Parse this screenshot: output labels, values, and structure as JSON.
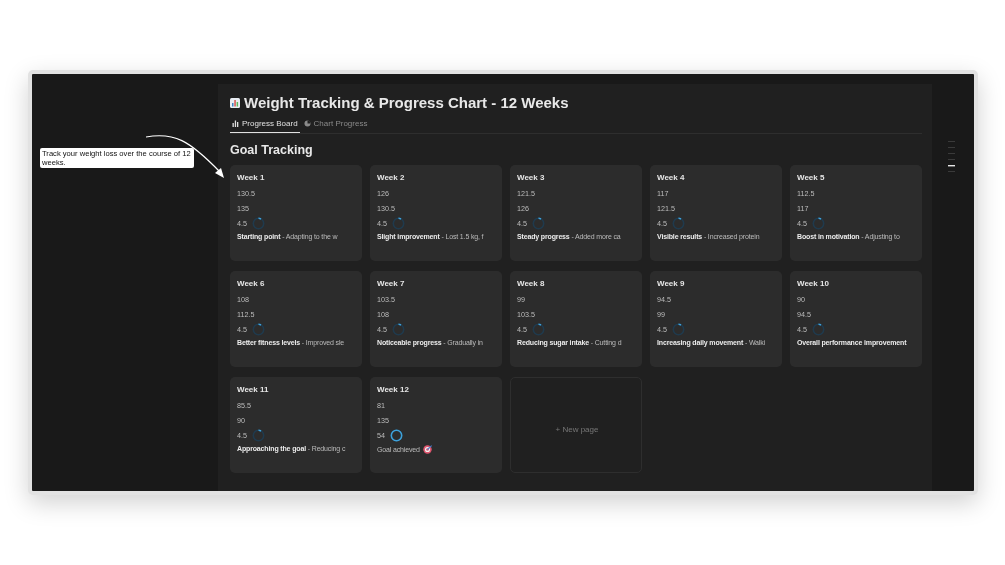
{
  "annotation": {
    "text": "Track your weight loss over the course of 12 weeks."
  },
  "page": {
    "title": "Weight Tracking & Progress Chart - 12 Weeks"
  },
  "tabs": [
    {
      "label": "Progress Board",
      "selected": true
    },
    {
      "label": "Chart Progress",
      "selected": false
    }
  ],
  "section": {
    "title": "Goal Tracking"
  },
  "cards": [
    {
      "title": "Week 1",
      "current": "130.5",
      "previous": "135",
      "lost": "4.5",
      "level": 0.08,
      "note": "**Starting point** - Adapting to the w"
    },
    {
      "title": "Week 2",
      "current": "126",
      "previous": "130.5",
      "lost": "4.5",
      "level": 0.08,
      "note": "**Slight improvement** - Lost 1.5 kg, f"
    },
    {
      "title": "Week 3",
      "current": "121.5",
      "previous": "126",
      "lost": "4.5",
      "level": 0.08,
      "note": "**Steady progress** - Added more ca"
    },
    {
      "title": "Week 4",
      "current": "117",
      "previous": "121.5",
      "lost": "4.5",
      "level": 0.08,
      "note": "**Visible results** - Increased protein"
    },
    {
      "title": "Week 5",
      "current": "112.5",
      "previous": "117",
      "lost": "4.5",
      "level": 0.08,
      "note": "**Boost in motivation** - Adjusting to"
    },
    {
      "title": "Week 6",
      "current": "108",
      "previous": "112.5",
      "lost": "4.5",
      "level": 0.08,
      "note": "**Better fitness levels** - Improved sle"
    },
    {
      "title": "Week 7",
      "current": "103.5",
      "previous": "108",
      "lost": "4.5",
      "level": 0.08,
      "note": "**Noticeable progress** - Gradually in"
    },
    {
      "title": "Week 8",
      "current": "99",
      "previous": "103.5",
      "lost": "4.5",
      "level": 0.08,
      "note": "**Reducing sugar intake** - Cutting d"
    },
    {
      "title": "Week 9",
      "current": "94.5",
      "previous": "99",
      "lost": "4.5",
      "level": 0.08,
      "note": "**Increasing daily movement** - Walki"
    },
    {
      "title": "Week 10",
      "current": "90",
      "previous": "94.5",
      "lost": "4.5",
      "level": 0.08,
      "note": "**Overall performance improvement**"
    },
    {
      "title": "Week 11",
      "current": "85.5",
      "previous": "90",
      "lost": "4.5",
      "level": 0.08,
      "note": "**Approaching the goal** - Reducing c"
    },
    {
      "title": "Week 12",
      "current": "81",
      "previous": "135",
      "lost": "54",
      "level": 1,
      "note": "Goal achieved",
      "kind": "goal"
    }
  ],
  "new_page": {
    "label": "+ New page"
  }
}
